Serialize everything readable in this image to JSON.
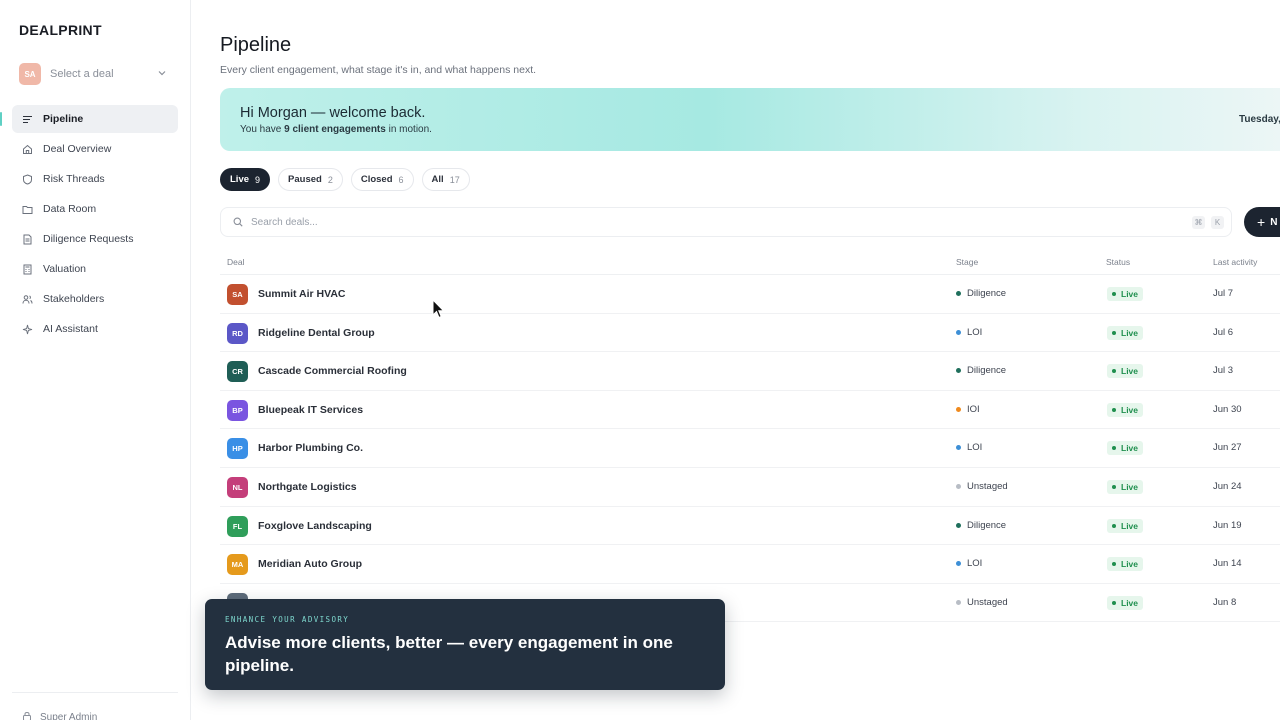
{
  "app": {
    "brand": "DEALPRINT"
  },
  "deal_selector": {
    "initials": "SA",
    "placeholder": "Select a deal"
  },
  "sidebar": {
    "items": [
      {
        "label": "Pipeline",
        "icon": "pipeline-icon",
        "active": true
      },
      {
        "label": "Deal Overview",
        "icon": "home-icon"
      },
      {
        "label": "Risk Threads",
        "icon": "shield-icon"
      },
      {
        "label": "Data Room",
        "icon": "folder-icon"
      },
      {
        "label": "Diligence Requests",
        "icon": "document-icon"
      },
      {
        "label": "Valuation",
        "icon": "calculator-icon"
      },
      {
        "label": "Stakeholders",
        "icon": "users-icon"
      },
      {
        "label": "AI Assistant",
        "icon": "sparkle-icon"
      }
    ],
    "footer": {
      "label": "Super Admin",
      "icon": "lock-icon"
    }
  },
  "header": {
    "title": "Pipeline",
    "subtitle": "Every client engagement, what stage it's in, and what happens next."
  },
  "banner": {
    "greeting": "Hi Morgan — welcome back.",
    "sub_prefix": "You have ",
    "sub_bold": "9 client engagements",
    "sub_suffix": " in motion.",
    "date": "Tuesday,"
  },
  "tabs": [
    {
      "label": "Live",
      "count": "9",
      "active": true
    },
    {
      "label": "Paused",
      "count": "2"
    },
    {
      "label": "Closed",
      "count": "6"
    },
    {
      "label": "All",
      "count": "17"
    }
  ],
  "search": {
    "placeholder": "Search deals...",
    "shortcut_1": "⌘",
    "shortcut_2": "K"
  },
  "new_button": {
    "label": "N"
  },
  "table": {
    "columns": {
      "deal": "Deal",
      "stage": "Stage",
      "status": "Status",
      "last": "Last activity"
    },
    "rows": [
      {
        "initials": "SA",
        "name": "Summit Air HVAC",
        "color": "#c2502f",
        "stage": "Diligence",
        "stage_color": "#1f6f5c",
        "status": "Live",
        "last": "Jul 7"
      },
      {
        "initials": "RD",
        "name": "Ridgeline Dental Group",
        "color": "#5b57c7",
        "stage": "LOI",
        "stage_color": "#3d8fd6",
        "status": "Live",
        "last": "Jul 6"
      },
      {
        "initials": "CR",
        "name": "Cascade Commercial Roofing",
        "color": "#1f5e56",
        "stage": "Diligence",
        "stage_color": "#1f6f5c",
        "status": "Live",
        "last": "Jul 3"
      },
      {
        "initials": "BP",
        "name": "Bluepeak IT Services",
        "color": "#7a55e0",
        "stage": "IOI",
        "stage_color": "#ef8a1e",
        "status": "Live",
        "last": "Jun 30"
      },
      {
        "initials": "HP",
        "name": "Harbor Plumbing Co.",
        "color": "#3a8fe6",
        "stage": "LOI",
        "stage_color": "#3d8fd6",
        "status": "Live",
        "last": "Jun 27"
      },
      {
        "initials": "NL",
        "name": "Northgate Logistics",
        "color": "#c43e7a",
        "stage": "Unstaged",
        "stage_color": "#b8bdc5",
        "status": "Live",
        "last": "Jun 24"
      },
      {
        "initials": "FL",
        "name": "Foxglove Landscaping",
        "color": "#2f9e5a",
        "stage": "Diligence",
        "stage_color": "#1f6f5c",
        "status": "Live",
        "last": "Jun 19"
      },
      {
        "initials": "MA",
        "name": "Meridian Auto Group",
        "color": "#e59a1c",
        "stage": "LOI",
        "stage_color": "#3d8fd6",
        "status": "Live",
        "last": "Jun 14"
      },
      {
        "initials": "",
        "name": "",
        "color": "#5d6b7a",
        "stage": "Unstaged",
        "stage_color": "#b8bdc5",
        "status": "Live",
        "last": "Jun 8"
      }
    ]
  },
  "promo": {
    "kicker": "ENHANCE YOUR ADVISORY",
    "headline": "Advise more clients, better — every engagement in one pipeline."
  }
}
